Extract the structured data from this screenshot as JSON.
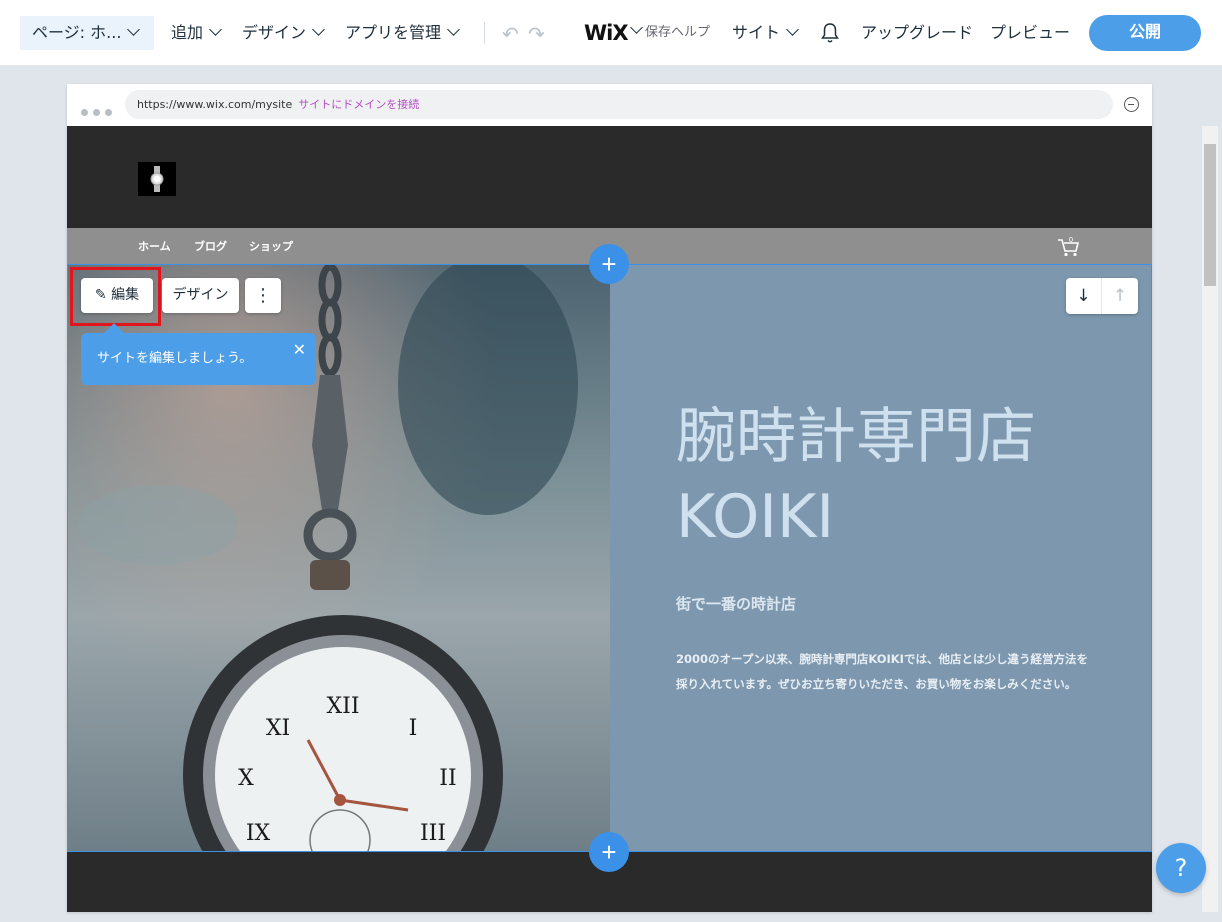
{
  "topbar": {
    "page_select": "ページ: ホ...",
    "add": "追加",
    "design": "デザイン",
    "manage_apps": "アプリを管理",
    "logo": "WiX",
    "save_help": "保存ヘルプ",
    "site": "サイト",
    "upgrade": "アップグレード",
    "preview": "プレビュー",
    "publish": "公開"
  },
  "browser": {
    "url": "https://www.wix.com/mysite",
    "connect_domain": "サイトにドメインを接続"
  },
  "site": {
    "nav": [
      "ホーム",
      "ブログ",
      "ショップ"
    ],
    "cart_count": "0",
    "hero": {
      "title_line1": "腕時計専門店",
      "title_line2": "KOIKI",
      "subtitle": "街で一番の時計店",
      "body": "2000のオープン以来、腕時計専門店KOIKIでは、他店とは少し違う経営方法を採り入れています。ぜひお立ち寄りいただき、お買い物をお楽しみください。"
    }
  },
  "editor": {
    "edit_button": "編集",
    "design_button": "デザイン",
    "more_button": "⋮",
    "tooltip_text": "サイトを編集しましょう。",
    "tooltip_close": "✕",
    "plus": "+",
    "move_down": "↓",
    "move_up": "↑",
    "help": "?"
  },
  "colors": {
    "accent": "#3b91e8",
    "highlight": "#e0161c",
    "hero_panel": "#7d98ae"
  }
}
